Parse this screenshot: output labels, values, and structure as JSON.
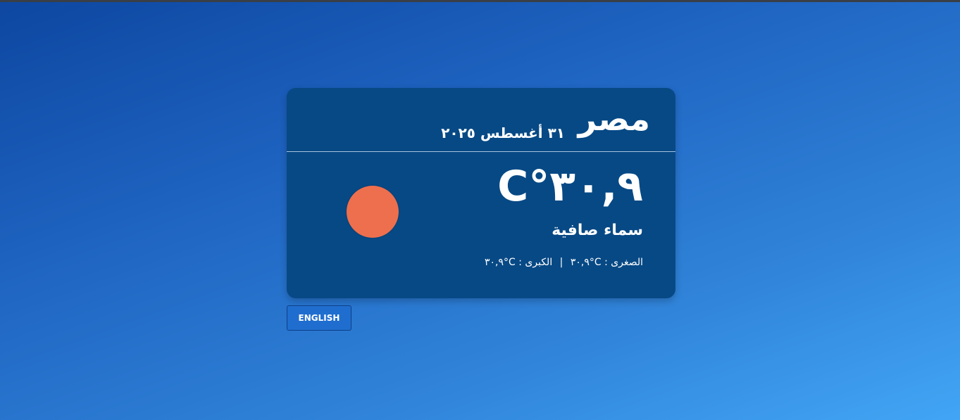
{
  "weather": {
    "city": "مصر",
    "date": "٣١ أغسطس ٢٠٢٥",
    "temperature": "C°٣٠,٩",
    "condition": "سماء صافية",
    "min_label": "الصغرى :",
    "min_value": "C°٣٠,٩",
    "separator": "|",
    "max_label": "الكبرى :",
    "max_value": "C°٣٠,٩",
    "icon": "sun-icon",
    "icon_color": "#ee6f4d"
  },
  "language_button": {
    "label": "ENGLISH"
  },
  "colors": {
    "card_background": "#074985",
    "background_gradient_start": "#0d47a1",
    "background_gradient_end": "#42a5f5"
  }
}
